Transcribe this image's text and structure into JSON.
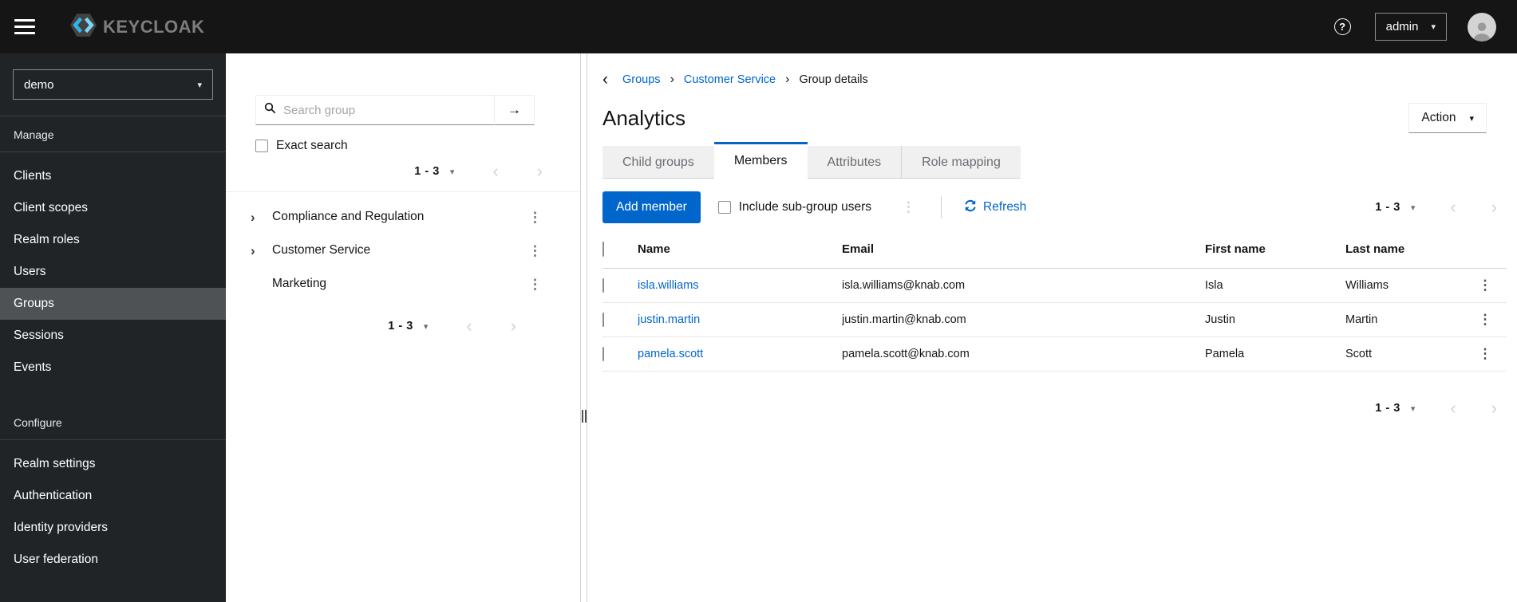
{
  "masthead": {
    "brand": "KEYCLOAK",
    "user": "admin"
  },
  "sidebar": {
    "realm_selector": {
      "value": "demo"
    },
    "sections": [
      {
        "title": "Manage",
        "items": [
          {
            "label": "Clients",
            "active": false
          },
          {
            "label": "Client scopes",
            "active": false
          },
          {
            "label": "Realm roles",
            "active": false
          },
          {
            "label": "Users",
            "active": false
          },
          {
            "label": "Groups",
            "active": true
          },
          {
            "label": "Sessions",
            "active": false
          },
          {
            "label": "Events",
            "active": false
          }
        ]
      },
      {
        "title": "Configure",
        "items": [
          {
            "label": "Realm settings",
            "active": false
          },
          {
            "label": "Authentication",
            "active": false
          },
          {
            "label": "Identity providers",
            "active": false
          },
          {
            "label": "User federation",
            "active": false
          }
        ]
      }
    ]
  },
  "group_tree": {
    "search": {
      "placeholder": "Search group"
    },
    "exact_search_label": "Exact search",
    "pagination_top": {
      "range": "1 - 3"
    },
    "items": [
      {
        "label": "Compliance and Regulation",
        "expandable": true
      },
      {
        "label": "Customer Service",
        "expandable": true
      },
      {
        "label": "Marketing",
        "expandable": false
      }
    ],
    "pagination_bottom": {
      "range": "1 - 3"
    }
  },
  "main": {
    "breadcrumb": {
      "items": [
        {
          "label": "Groups",
          "link": true
        },
        {
          "label": "Customer Service",
          "link": true
        },
        {
          "label": "Group details",
          "link": false
        }
      ]
    },
    "title": "Analytics",
    "action_button_label": "Action",
    "tabs": [
      {
        "label": "Child groups",
        "active": false
      },
      {
        "label": "Members",
        "active": true
      },
      {
        "label": "Attributes",
        "active": false
      },
      {
        "label": "Role mapping",
        "active": false
      }
    ],
    "toolbar": {
      "add_member_label": "Add member",
      "include_subgroup_label": "Include sub-group users",
      "refresh_label": "Refresh",
      "pagination": {
        "range": "1 - 3"
      }
    },
    "table": {
      "headers": [
        "Name",
        "Email",
        "First name",
        "Last name"
      ],
      "rows": [
        {
          "name": "isla.williams",
          "email": "isla.williams@knab.com",
          "first": "Isla",
          "last": "Williams"
        },
        {
          "name": "justin.martin",
          "email": "justin.martin@knab.com",
          "first": "Justin",
          "last": "Martin"
        },
        {
          "name": "pamela.scott",
          "email": "pamela.scott@knab.com",
          "first": "Pamela",
          "last": "Scott"
        }
      ]
    },
    "pagination_bottom": {
      "range": "1 - 3"
    }
  },
  "colors": {
    "primary": "#0066cc",
    "link": "#0066cc",
    "masthead_bg": "#151515",
    "sidebar_bg": "#212427",
    "sidebar_active_bg": "#4f5255",
    "tab_inactive_bg": "#f0f0f0"
  }
}
